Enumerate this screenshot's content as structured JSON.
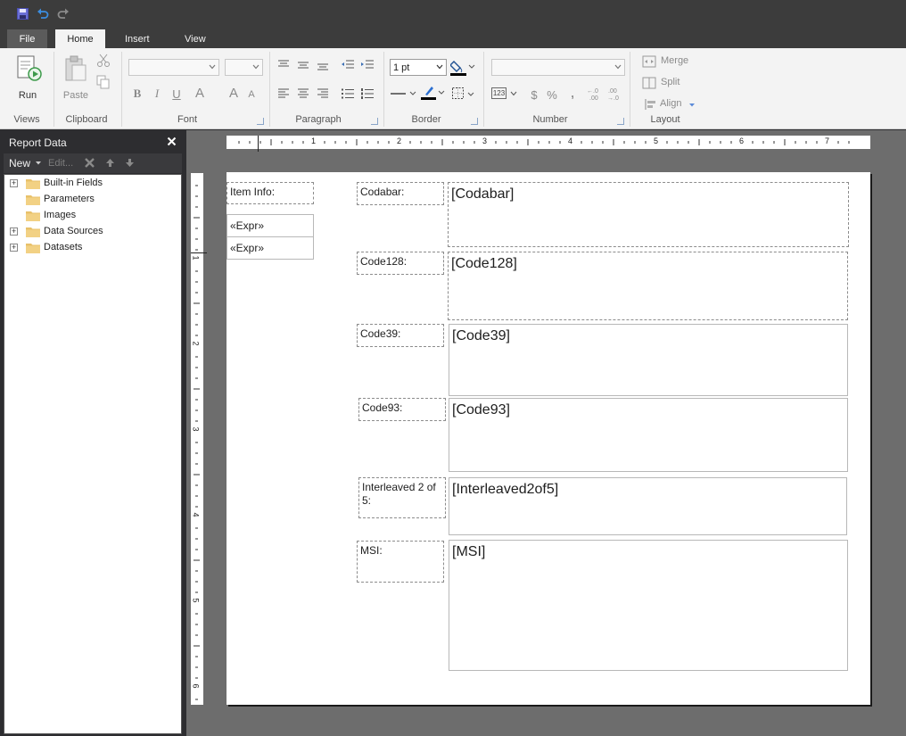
{
  "tabs": {
    "file": "File",
    "home": "Home",
    "insert": "Insert",
    "view": "View"
  },
  "ribbon": {
    "views": {
      "run_label": "Run",
      "group": "Views"
    },
    "clipboard": {
      "paste_label": "Paste",
      "group": "Clipboard"
    },
    "font": {
      "group": "Font",
      "bold": "B",
      "italic": "I",
      "underline": "U",
      "font_color": "A",
      "grow": "A",
      "shrink": "A"
    },
    "paragraph": {
      "group": "Paragraph"
    },
    "border": {
      "group": "Border",
      "width_value": "1 pt"
    },
    "number": {
      "group": "Number",
      "dollar": "$",
      "percent": "%",
      "comma": ",",
      "increase": "←.0\n.00",
      "decrease": ".00\n→.0",
      "placeholder_icon": "123"
    },
    "layout": {
      "group": "Layout",
      "merge": "Merge",
      "split": "Split",
      "align": "Align"
    }
  },
  "report_data": {
    "title": "Report Data",
    "new_label": "New",
    "edit_label": "Edit...",
    "tree": [
      {
        "label": "Built-in Fields",
        "expandable": true
      },
      {
        "label": "Parameters",
        "expandable": false
      },
      {
        "label": "Images",
        "expandable": false
      },
      {
        "label": "Data Sources",
        "expandable": true
      },
      {
        "label": "Datasets",
        "expandable": true
      }
    ]
  },
  "rulers": {
    "h_numbers": [
      "1",
      "2",
      "3",
      "4",
      "5",
      "6",
      "7"
    ],
    "v_numbers": [
      "1",
      "2",
      "3",
      "4",
      "5",
      "6"
    ]
  },
  "report": {
    "item_info": "Item Info:",
    "expr1": "«Expr»",
    "expr2": "«Expr»",
    "rows": [
      {
        "label": "Codabar:",
        "value": "[Codabar]"
      },
      {
        "label": "Code128:",
        "value": "[Code128]"
      },
      {
        "label": "Code39:",
        "value": "[Code39]"
      },
      {
        "label": "Code93:",
        "value": "[Code93]"
      },
      {
        "label": "Interleaved 2 of 5:",
        "value": "[Interleaved2of5]"
      },
      {
        "label": "MSI:",
        "value": "[MSI]"
      }
    ]
  },
  "colors": {
    "accent": "#2b579a",
    "chrome": "#3c3c3c",
    "ribbon": "#f3f3f3",
    "surface": "#6d6d6d"
  }
}
